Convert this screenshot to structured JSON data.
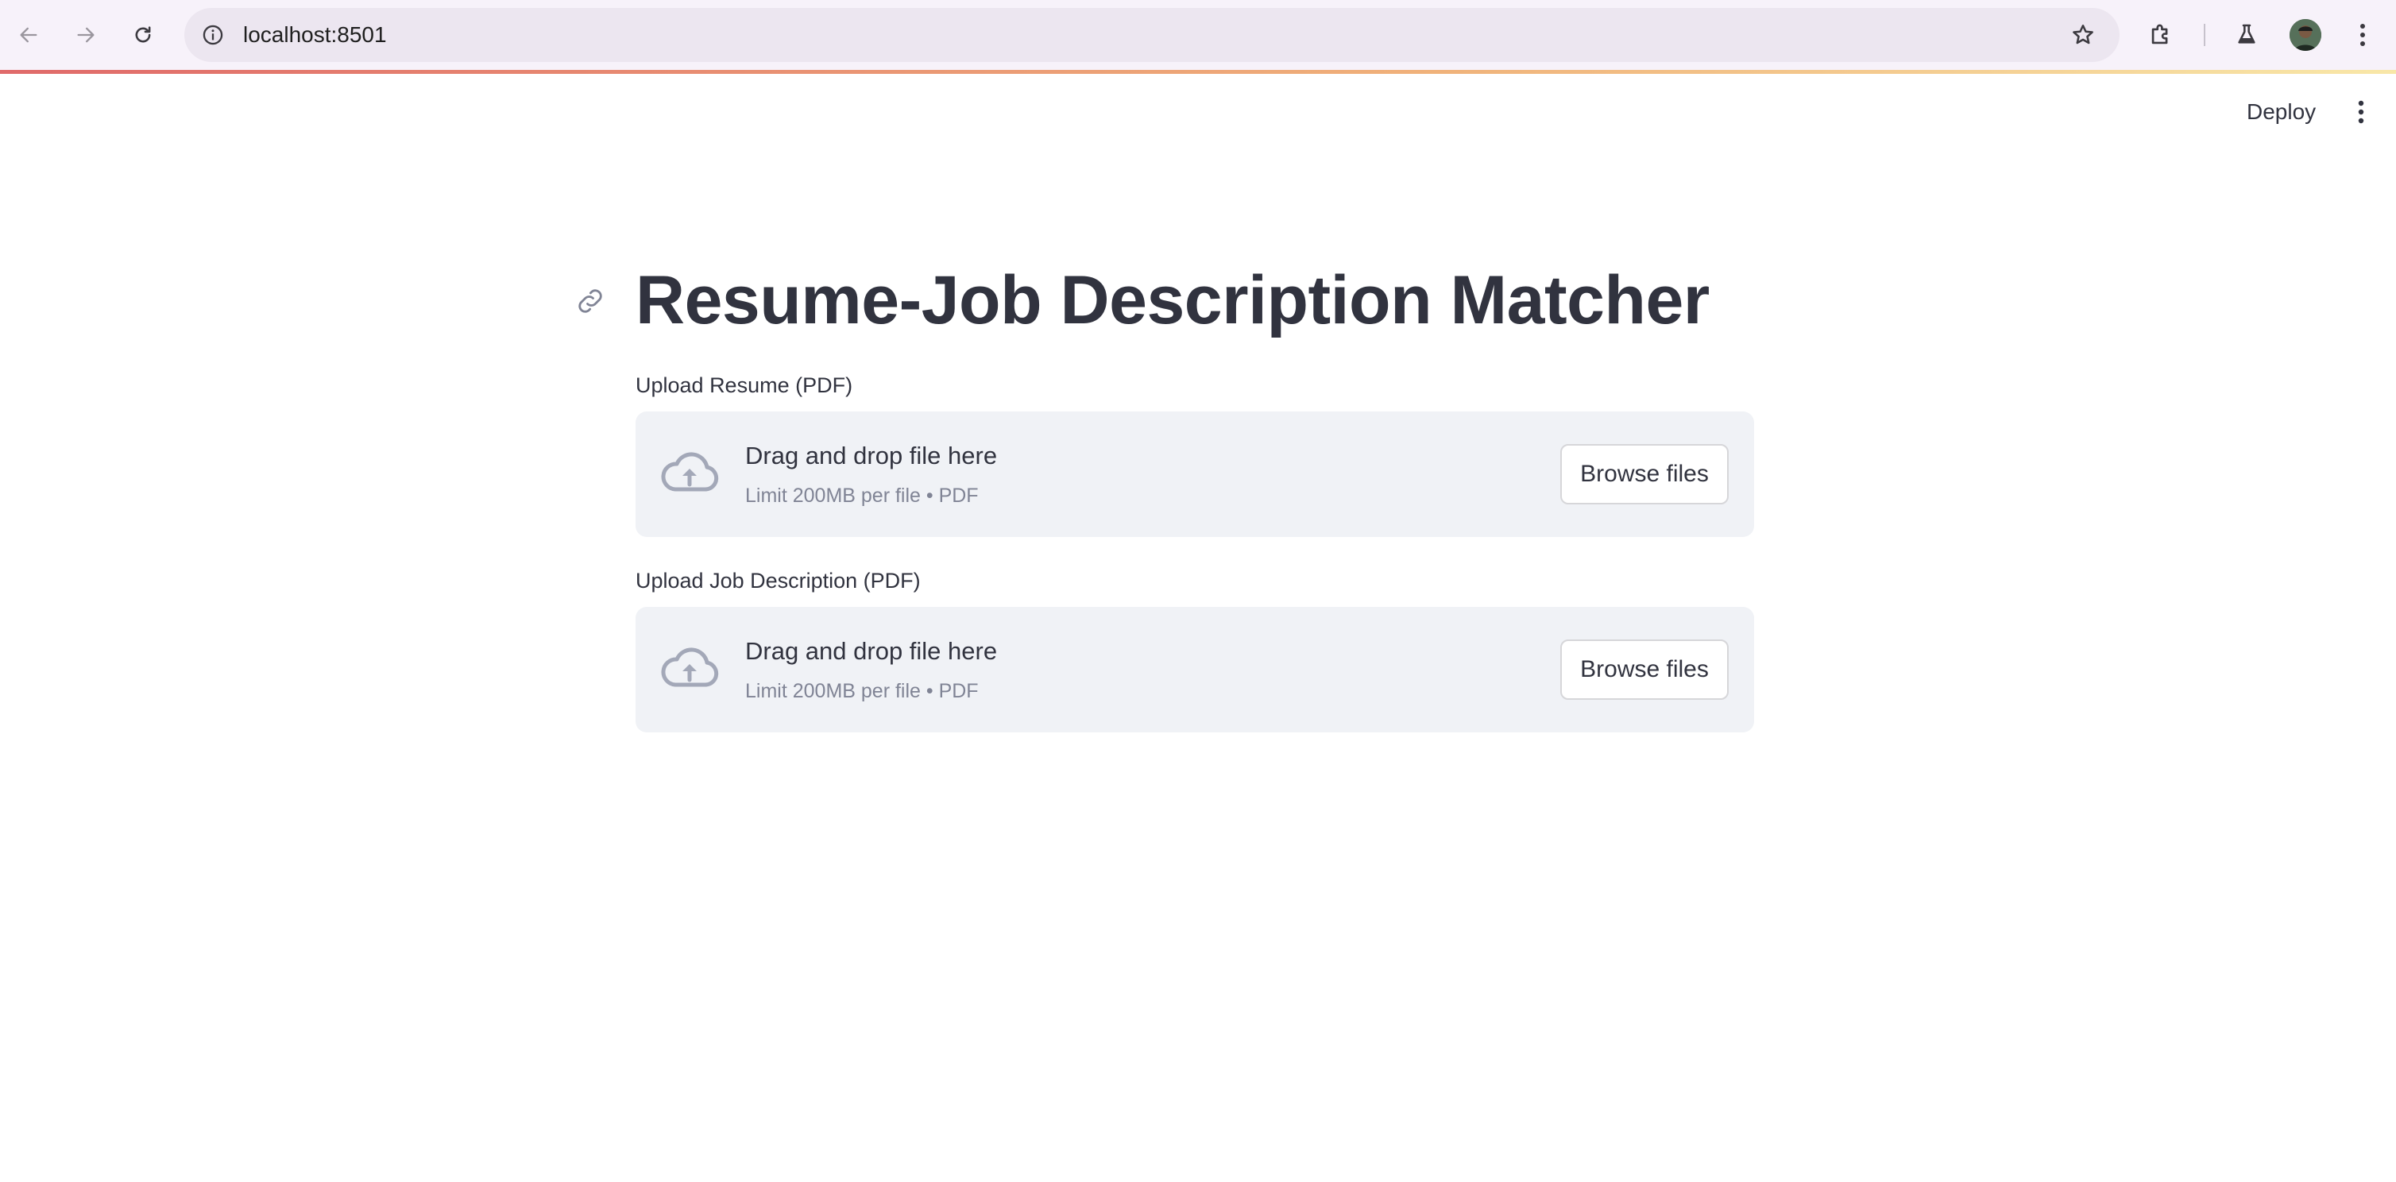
{
  "browser": {
    "url": "localhost:8501",
    "icons": {
      "back": "arrow-left-icon",
      "forward": "arrow-right-icon",
      "reload": "reload-icon",
      "site_info": "info-icon",
      "bookmark": "star-icon",
      "extensions": "puzzle-icon",
      "labs": "flask-icon",
      "profile": "avatar",
      "menu": "kebab-menu-icon"
    },
    "accent_gradient": [
      "#e06a6a",
      "#f0b27a",
      "#f8e7a8"
    ]
  },
  "app_header": {
    "deploy_label": "Deploy",
    "menu_icon": "kebab-menu-icon"
  },
  "main": {
    "title": "Resume-Job Description Matcher",
    "anchor_icon": "link-icon",
    "uploaders": [
      {
        "label": "Upload Resume (PDF)",
        "dropzone_title": "Drag and drop file here",
        "dropzone_subtitle": "Limit 200MB per file • PDF",
        "button_label": "Browse files",
        "icon": "cloud-upload-icon"
      },
      {
        "label": "Upload Job Description (PDF)",
        "dropzone_title": "Drag and drop file here",
        "dropzone_subtitle": "Limit 200MB per file • PDF",
        "button_label": "Browse files",
        "icon": "cloud-upload-icon"
      }
    ]
  },
  "colors": {
    "text_primary": "#31333f",
    "text_secondary": "#808495",
    "dropzone_bg": "#f0f2f6",
    "icon_muted": "#a3a8b8"
  }
}
